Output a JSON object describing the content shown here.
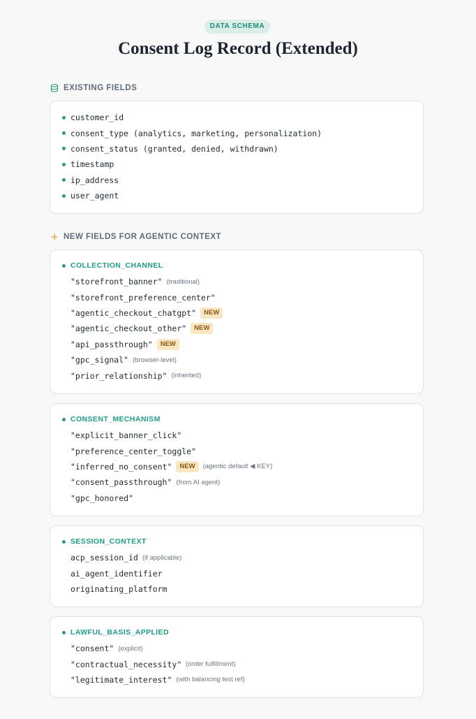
{
  "header": {
    "badge": "DATA SCHEMA",
    "title": "Consent Log Record (Extended)"
  },
  "existing": {
    "heading": "EXISTING FIELDS",
    "icon": "database-icon",
    "fields": [
      "customer_id",
      "consent_type (analytics, marketing, personalization)",
      "consent_status (granted, denied, withdrawn)",
      "timestamp",
      "ip_address",
      "user_agent"
    ]
  },
  "new_section": {
    "heading": "NEW FIELDS FOR AGENTIC CONTEXT",
    "icon": "plus-icon"
  },
  "new_label": "NEW",
  "groups": [
    {
      "name": "COLLECTION_CHANNEL",
      "items": [
        {
          "value": "\"storefront_banner\"",
          "note": "(traditional)",
          "new": false
        },
        {
          "value": "\"storefront_preference_center\"",
          "note": "",
          "new": false
        },
        {
          "value": "\"agentic_checkout_chatgpt\"",
          "note": "",
          "new": true
        },
        {
          "value": "\"agentic_checkout_other\"",
          "note": "",
          "new": true
        },
        {
          "value": "\"api_passthrough\"",
          "note": "",
          "new": true
        },
        {
          "value": "\"gpc_signal\"",
          "note": "(browser-level)",
          "new": false
        },
        {
          "value": "\"prior_relationship\"",
          "note": "(inherited)",
          "new": false
        }
      ]
    },
    {
      "name": "CONSENT_MECHANISM",
      "items": [
        {
          "value": "\"explicit_banner_click\"",
          "note": "",
          "new": false
        },
        {
          "value": "\"preference_center_toggle\"",
          "note": "",
          "new": false
        },
        {
          "value": "\"inferred_no_consent\"",
          "note": "(agentic default ◀ KEY)",
          "new": true
        },
        {
          "value": "\"consent_passthrough\"",
          "note": "(from AI agent)",
          "new": false
        },
        {
          "value": "\"gpc_honored\"",
          "note": "",
          "new": false
        }
      ]
    },
    {
      "name": "SESSION_CONTEXT",
      "items": [
        {
          "value": "acp_session_id",
          "note": "(if applicable)",
          "new": false
        },
        {
          "value": "ai_agent_identifier",
          "note": "",
          "new": false
        },
        {
          "value": "originating_platform",
          "note": "",
          "new": false
        }
      ]
    },
    {
      "name": "LAWFUL_BASIS_APPLIED",
      "items": [
        {
          "value": "\"consent\"",
          "note": "(explicit)",
          "new": false
        },
        {
          "value": "\"contractual_necessity\"",
          "note": "(order fulfillment)",
          "new": false
        },
        {
          "value": "\"legitimate_interest\"",
          "note": "(with balancing test ref)",
          "new": false
        }
      ]
    }
  ],
  "colors": {
    "accent": "#1f9c85",
    "badge_bg": "#dbefe8",
    "new_bg": "#fbe6c4",
    "new_fg": "#8a5a12",
    "plus": "#e8a23c"
  }
}
